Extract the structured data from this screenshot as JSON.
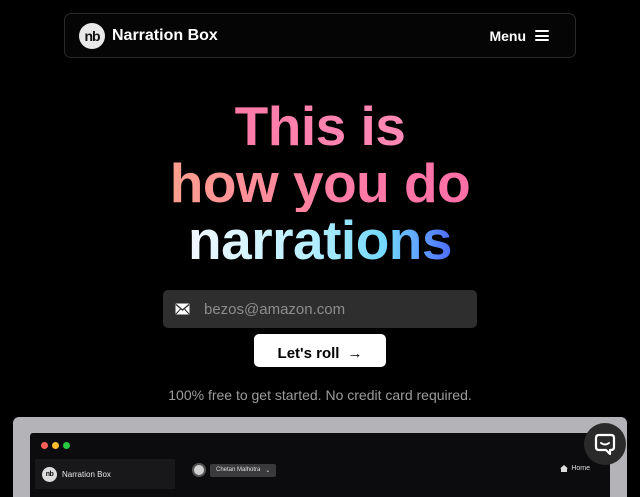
{
  "nav": {
    "logo_text": "nb",
    "brand": "Narration Box",
    "menu_label": "Menu"
  },
  "hero": {
    "line1": "This is",
    "line2": "how you do",
    "line3": "narrations"
  },
  "signup": {
    "email_placeholder": "bezos@amazon.com",
    "cta_label": "Let's roll",
    "cta_arrow": "→",
    "note": "100% free to get started. No credit card required."
  },
  "preview": {
    "window_dots": [
      "#ff5f57",
      "#febc2e",
      "#28c840"
    ],
    "logo_text": "nb",
    "brand": "Narration Box",
    "user_name": "Chetan Malhotra",
    "home_label": "Home"
  },
  "icons": {
    "menu": "hamburger-icon",
    "email": "envelope-icon",
    "cta": "arrow-right-icon",
    "chat": "chat-bubble-icon",
    "home": "home-icon"
  }
}
